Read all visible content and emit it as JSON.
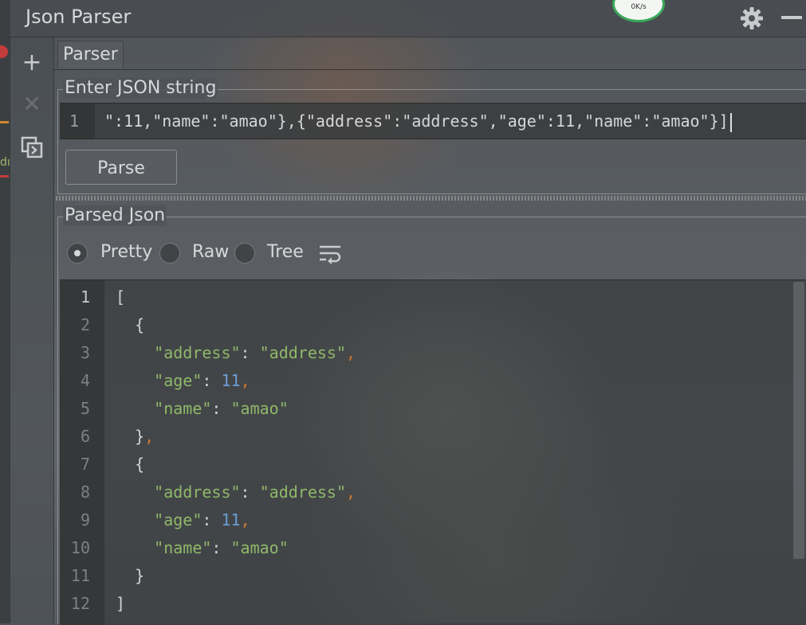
{
  "window": {
    "title": "Json Parser",
    "net_speed": "0K/s"
  },
  "left_strip": {
    "fragment": "dı"
  },
  "tabs": [
    {
      "label": "Parser"
    }
  ],
  "input_group": {
    "title": "Enter JSON string",
    "line_number": "1",
    "text": "\":11,\"name\":\"amao\"},{\"address\":\"address\",\"age\":11,\"name\":\"amao\"}]",
    "parse_label": "Parse"
  },
  "output_group": {
    "title": "Parsed Json",
    "views": [
      {
        "label": "Pretty",
        "selected": true
      },
      {
        "label": "Raw",
        "selected": false
      },
      {
        "label": "Tree",
        "selected": false
      }
    ],
    "lines": [
      {
        "n": "1",
        "indent": "",
        "parts": [
          {
            "t": "[",
            "c": "p"
          }
        ]
      },
      {
        "n": "2",
        "indent": "  ",
        "parts": [
          {
            "t": "{",
            "c": "p"
          }
        ]
      },
      {
        "n": "3",
        "indent": "    ",
        "parts": [
          {
            "t": "\"address\"",
            "c": "k"
          },
          {
            "t": ": ",
            "c": "p"
          },
          {
            "t": "\"address\"",
            "c": "s"
          },
          {
            "t": ",",
            "c": "c"
          }
        ]
      },
      {
        "n": "4",
        "indent": "    ",
        "parts": [
          {
            "t": "\"age\"",
            "c": "k"
          },
          {
            "t": ": ",
            "c": "p"
          },
          {
            "t": "11",
            "c": "n"
          },
          {
            "t": ",",
            "c": "c"
          }
        ]
      },
      {
        "n": "5",
        "indent": "    ",
        "parts": [
          {
            "t": "\"name\"",
            "c": "k"
          },
          {
            "t": ": ",
            "c": "p"
          },
          {
            "t": "\"amao\"",
            "c": "s"
          }
        ]
      },
      {
        "n": "6",
        "indent": "  ",
        "parts": [
          {
            "t": "}",
            "c": "p"
          },
          {
            "t": ",",
            "c": "c"
          }
        ]
      },
      {
        "n": "7",
        "indent": "  ",
        "parts": [
          {
            "t": "{",
            "c": "p"
          }
        ]
      },
      {
        "n": "8",
        "indent": "    ",
        "parts": [
          {
            "t": "\"address\"",
            "c": "k"
          },
          {
            "t": ": ",
            "c": "p"
          },
          {
            "t": "\"address\"",
            "c": "s"
          },
          {
            "t": ",",
            "c": "c"
          }
        ]
      },
      {
        "n": "9",
        "indent": "    ",
        "parts": [
          {
            "t": "\"age\"",
            "c": "k"
          },
          {
            "t": ": ",
            "c": "p"
          },
          {
            "t": "11",
            "c": "n"
          },
          {
            "t": ",",
            "c": "c"
          }
        ]
      },
      {
        "n": "10",
        "indent": "    ",
        "parts": [
          {
            "t": "\"name\"",
            "c": "k"
          },
          {
            "t": ": ",
            "c": "p"
          },
          {
            "t": "\"amao\"",
            "c": "s"
          }
        ]
      },
      {
        "n": "11",
        "indent": "  ",
        "parts": [
          {
            "t": "}",
            "c": "p"
          }
        ]
      },
      {
        "n": "12",
        "indent": "",
        "parts": [
          {
            "t": "]",
            "c": "p"
          }
        ]
      }
    ]
  },
  "icons": {
    "add": "plus-icon",
    "close": "close-icon",
    "restore": "restore-window-icon",
    "settings": "gear-icon",
    "minimize": "minimize-icon",
    "wrap": "soft-wrap-icon"
  },
  "colors": {
    "key_string": "#8fb86a",
    "number": "#6a9ed6",
    "punctuation_comma": "#cc7832",
    "text": "#cfd3d6"
  }
}
